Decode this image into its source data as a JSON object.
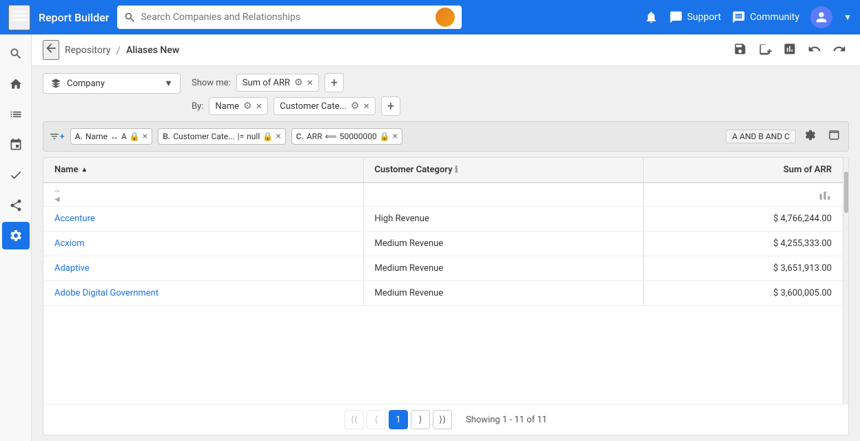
{
  "app": {
    "title": "Report Builder",
    "search_placeholder": "Search Companies and Relationships"
  },
  "nav": {
    "support_label": "Support",
    "community_label": "Community",
    "bell_icon": "bell",
    "chat_icon": "chat",
    "community_icon": "community",
    "user_icon": "user"
  },
  "breadcrumb": {
    "back_icon": "arrow-left",
    "repository": "Repository",
    "separator": "/",
    "current": "Aliases New"
  },
  "sidebar": {
    "items": [
      {
        "id": "search",
        "icon": "search"
      },
      {
        "id": "home",
        "icon": "home"
      },
      {
        "id": "list",
        "icon": "list"
      },
      {
        "id": "calendar",
        "icon": "calendar"
      },
      {
        "id": "check",
        "icon": "check"
      },
      {
        "id": "share",
        "icon": "share"
      },
      {
        "id": "settings",
        "icon": "settings"
      }
    ],
    "active": "settings"
  },
  "controls": {
    "company_label": "Company",
    "show_me_label": "Show me:",
    "by_label": "By:",
    "sum_of_arr": "Sum of ARR",
    "name_label": "Name",
    "customer_cate_label": "Customer Cate...",
    "add_icon": "+",
    "filter_logic": "A AND B AND C"
  },
  "filters": [
    {
      "id": "A",
      "field": "Name",
      "operator": "↔",
      "value": "A",
      "locked": true
    },
    {
      "id": "B",
      "field": "Customer Cate...",
      "operator": "|=",
      "value": "null",
      "locked": true
    },
    {
      "id": "C",
      "field": "ARR",
      "operator": "⟸",
      "value": "50000000",
      "locked": true
    }
  ],
  "table": {
    "columns": [
      {
        "id": "name",
        "label": "Name",
        "sortable": true,
        "sort_dir": "asc"
      },
      {
        "id": "customer_category",
        "label": "Customer Category",
        "info": true
      },
      {
        "id": "sum_of_arr",
        "label": "Sum of ARR",
        "align": "right"
      }
    ],
    "rows": [
      {
        "name": "Accenture",
        "customer_category": "High Revenue",
        "sum_of_arr": "$ 4,766,244.00"
      },
      {
        "name": "Acxiom",
        "customer_category": "Medium Revenue",
        "sum_of_arr": "$ 4,255,333.00"
      },
      {
        "name": "Adaptive",
        "customer_category": "Medium Revenue",
        "sum_of_arr": "$ 3,651,913.00"
      },
      {
        "name": "Adobe Digital Government",
        "customer_category": "Medium Revenue",
        "sum_of_arr": "$ 3,600,005.00"
      }
    ]
  },
  "pagination": {
    "first_icon": "⟨⟨",
    "prev_icon": "⟨",
    "next_icon": "⟩",
    "last_icon": "⟩⟩",
    "current_page": 1,
    "showing_text": "Showing",
    "range_start": 1,
    "range_end": 11,
    "of_text": "of",
    "total": 11
  }
}
